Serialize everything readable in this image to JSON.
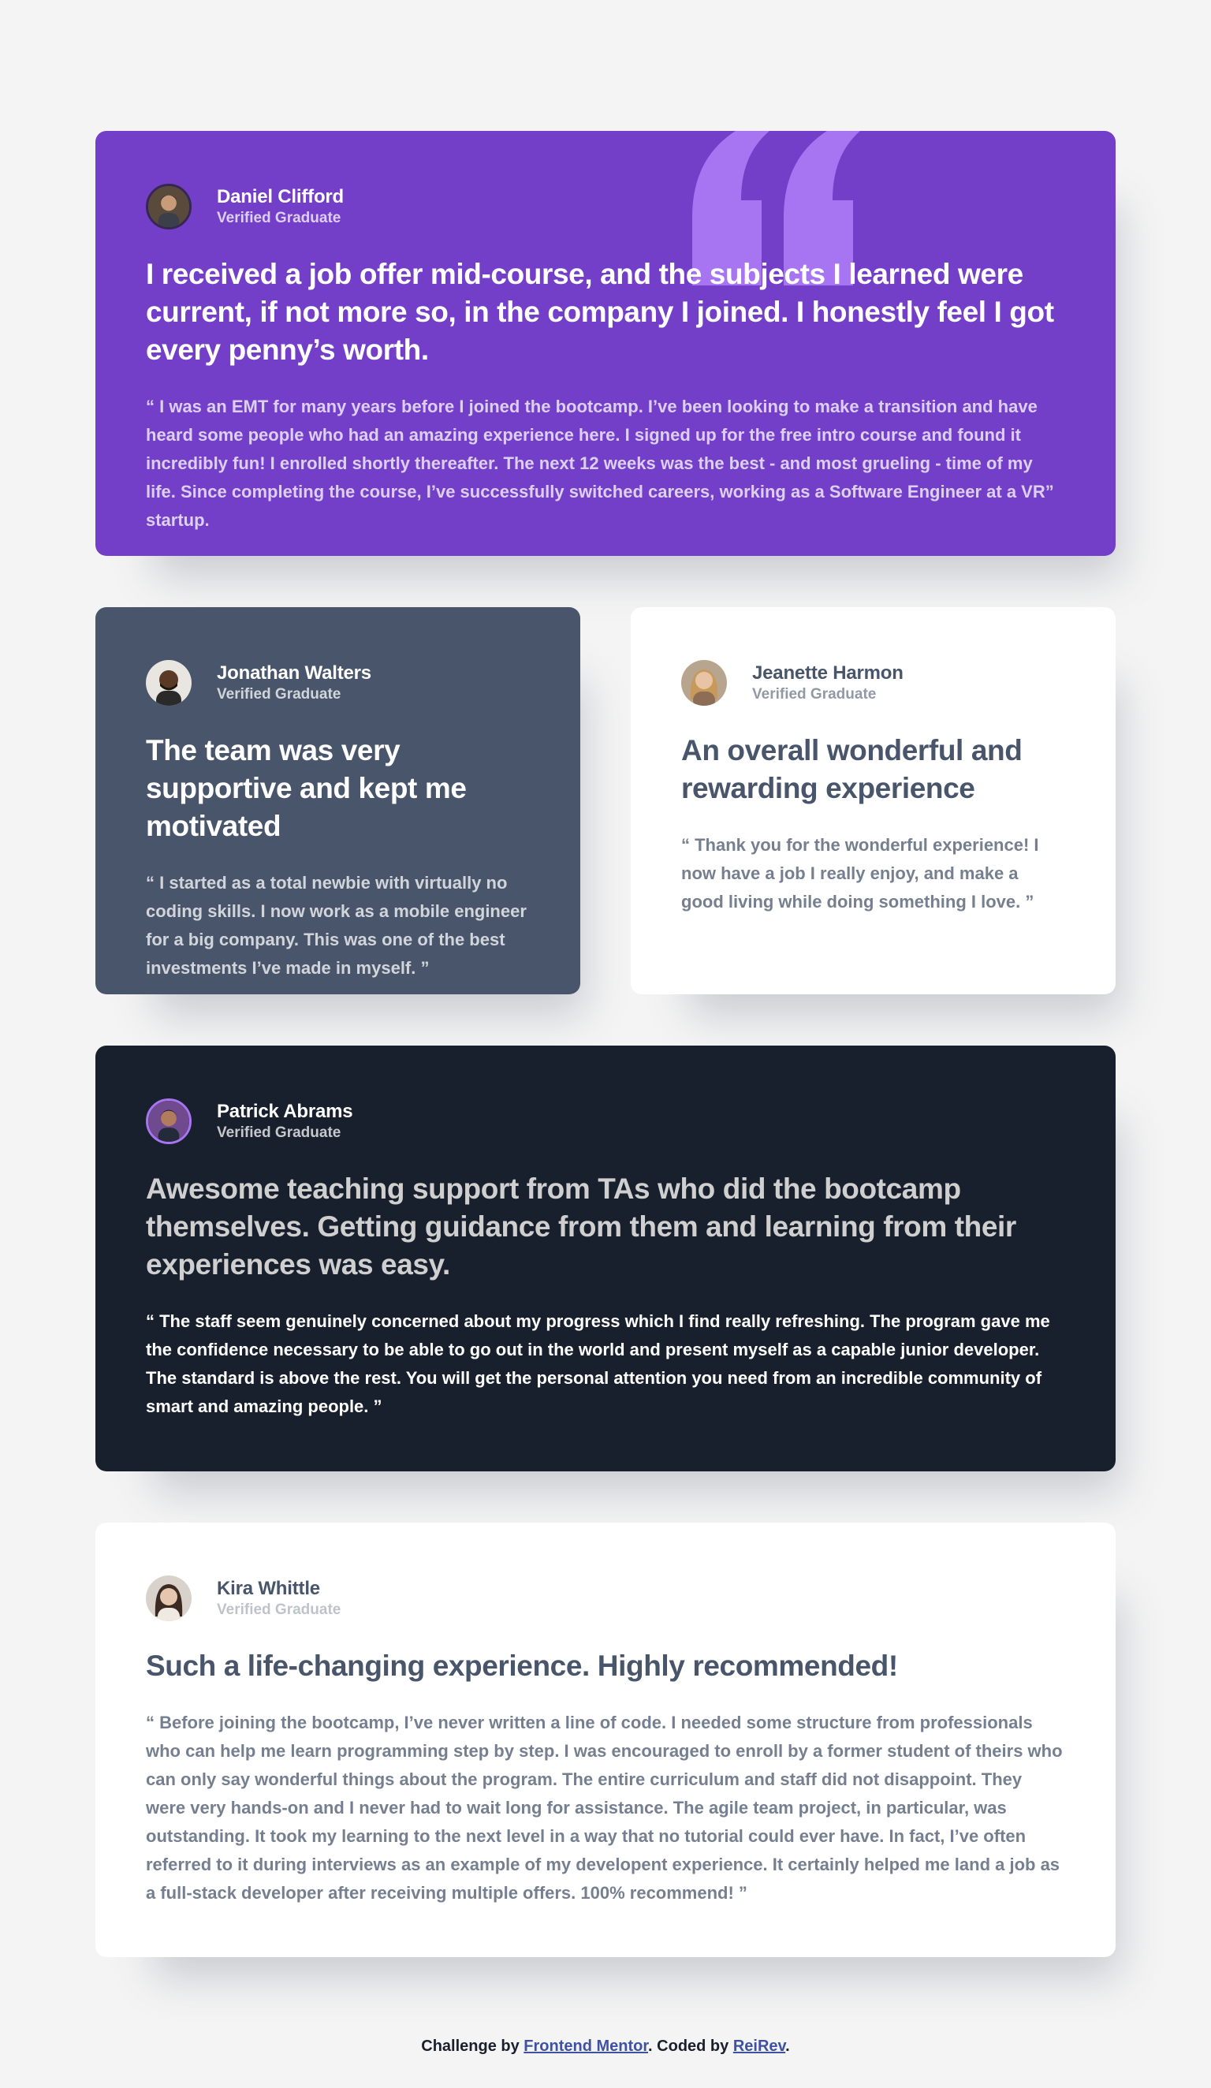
{
  "testimonials": [
    {
      "name": "Daniel Clifford",
      "role": "Verified Graduate",
      "headline": "I received a job offer mid-course, and the subjects I learned were current, if not more so, in the company I joined. I honestly feel I got every penny’s worth.",
      "quote": "“ I was an EMT for many years before I joined the bootcamp. I’ve been looking to make a transition and have heard some people who had an amazing experience here. I signed up for the free intro course and found it incredibly fun! I enrolled shortly thereafter. The next 12 weeks was the best - and most grueling - time of my life. Since completing the course, I’ve successfully switched careers, working as a Software Engineer at a VR” startup.",
      "background": "#733fc8"
    },
    {
      "name": "Jonathan Walters",
      "role": "Verified Graduate",
      "headline": "The team was very supportive and kept me motivated",
      "quote": "“ I started as a total newbie with virtually no coding skills. I now work as a mobile engineer for a big company. This was one of the best investments I’ve made in myself. ”",
      "background": "#48556a"
    },
    {
      "name": "Jeanette Harmon",
      "role": "Verified Graduate",
      "headline": "An overall wonderful and rewarding experience",
      "quote": "“ Thank you for the wonderful experience! I now have a job I really enjoy, and make a good living while doing something I love. ”",
      "background": "#ffffff"
    },
    {
      "name": "Patrick Abrams",
      "role": "Verified Graduate",
      "headline": "Awesome teaching support from TAs who did the bootcamp themselves. Getting guidance from them and learning from their experiences was easy.",
      "quote": "“ The staff seem genuinely concerned about my progress which I find really refreshing. The program gave me the confidence necessary to be able to go out in the world and present myself as a capable junior developer. The standard is above the rest. You will get the personal attention you need from an incredible community of smart and amazing people. ”",
      "background": "#19202d"
    },
    {
      "name": "Kira Whittle",
      "role": "Verified Graduate",
      "headline": "Such a life-changing experience. Highly recommended!",
      "quote": "“ Before joining the bootcamp, I’ve never written a line of code. I needed some structure from professionals who can help me learn programming step by step. I was encouraged to enroll by a former student of theirs who can only say wonderful things about the program. The entire curriculum and staff did not disappoint. They were very hands-on and I never had to wait long for assistance. The agile team project, in particular, was outstanding. It took my learning to the next level in a way that no tutorial could ever have. In fact, I’ve often referred to it during interviews as an example of my developent experience. It certainly helped me land a job as a full-stack developer after receiving multiple offers. 100% recommend! ”",
      "background": "#ffffff"
    }
  ],
  "footer": {
    "prefix": "Challenge by ",
    "link1": "Frontend Mentor",
    "middle": ". Coded by ",
    "link2": "ReiRev",
    "suffix": "."
  },
  "icons": {
    "quote": "quotation-mark-icon",
    "avatar": "avatar-photo"
  }
}
